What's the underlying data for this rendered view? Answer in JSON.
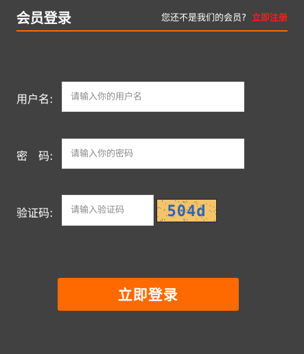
{
  "header": {
    "title": "会员登录",
    "prompt": "您还不是我们的会员?",
    "register_link": "立即注册"
  },
  "form": {
    "username": {
      "label": "用户名:",
      "placeholder": "请输入你的用户名",
      "value": ""
    },
    "password": {
      "label": "密　码:",
      "placeholder": "请输入你的密码",
      "value": ""
    },
    "captcha": {
      "label": "验证码:",
      "placeholder": "请输入验证码",
      "value": "",
      "image_text": "504d"
    },
    "submit_label": "立即登录"
  },
  "colors": {
    "background": "#414141",
    "accent": "#ff6a00",
    "register_link": "#ff1a1a",
    "captcha_bg": "#f3c469",
    "captcha_text": "#2f63b8"
  }
}
